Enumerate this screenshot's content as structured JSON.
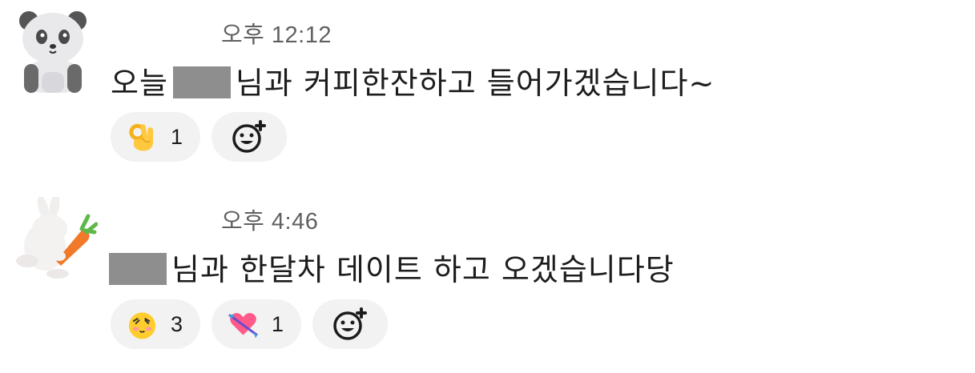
{
  "messages": [
    {
      "avatar": "panda-avatar",
      "time": "오후 12:12",
      "text_before": "오늘",
      "text_after": "님과 커피한잔하고 들어가겠습니다~",
      "reactions": [
        {
          "emoji": "ok-hand-icon",
          "count": "1"
        }
      ]
    },
    {
      "avatar": "rabbit-with-carrot-avatar",
      "time": "오후 4:46",
      "text_before": "",
      "text_after": "님과 한달차 데이트 하고 오겠습니다당",
      "reactions": [
        {
          "emoji": "blushing-face-icon",
          "count": "3"
        },
        {
          "emoji": "heart-with-arrow-icon",
          "count": "1"
        }
      ]
    }
  ],
  "colors": {
    "text": "#1d1c1d",
    "time": "#616061",
    "reaction_bg": "#f2f2f2",
    "redaction": "#8e8e8e"
  }
}
